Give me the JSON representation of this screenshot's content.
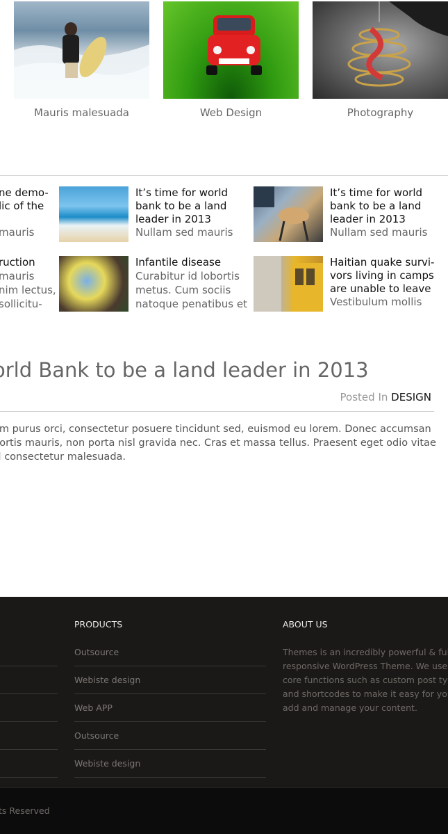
{
  "gallery": [
    {
      "caption": "Mauris malesuada"
    },
    {
      "caption": "Web Design"
    },
    {
      "caption": "Photography"
    }
  ],
  "related": {
    "left_column": [
      {
        "line1": "ne demo-",
        "line2": "lic of the",
        "line3": "",
        "line4": "mauris"
      },
      {
        "line1": "ruction",
        "line2": "mauris",
        "line3": "nim lectus,",
        "line4": "sollicitu-"
      }
    ],
    "posts": [
      {
        "title_lines": [
          "It’s time for world",
          "bank to be a land",
          "leader in 2013"
        ],
        "excerpt_lines": [
          "Nullam sed mauris"
        ]
      },
      {
        "title_lines": [
          "It’s time for world",
          "bank to be a land",
          "leader in 2013"
        ],
        "excerpt_lines": [
          "Nullam sed mauris"
        ]
      },
      {
        "title_lines": [
          "Infantile disease"
        ],
        "excerpt_lines": [
          "Curabitur id lobortis",
          "metus. Cum sociis",
          "natoque penatibus et"
        ]
      },
      {
        "title_lines": [
          "Haitian quake survi-",
          "vors living in camps",
          "are unable to leave"
        ],
        "excerpt_lines": [
          "Vestibulum mollis"
        ]
      }
    ]
  },
  "article": {
    "title": "orld Bank to be a land leader in 2013",
    "posted_in_label": "Posted In",
    "category": "DESIGN",
    "body_lines": [
      "am purus orci, consectetur posuere tincidunt sed, euismod eu lorem. Donec accumsan",
      "bortis mauris, non porta nisl gravida nec. Cras et massa tellus. Praesent eget odio vitae",
      "sl consectetur malesuada."
    ]
  },
  "footer": {
    "products_heading": "PRODUCTS",
    "products": [
      "Outsource",
      "Webiste design",
      "Web APP",
      "Outsource",
      "Webiste design"
    ],
    "about_heading": "ABOUT US",
    "about_lines": [
      "Themes is an incredibly powerful & fully",
      "responsive WordPress Theme. We use onl",
      "core functions such as custom post types",
      "and shortcodes to make it easy for you to",
      "add and manage your content."
    ],
    "copyright": "ts Reserved"
  },
  "colors": {
    "footer_bg": "#1b1918",
    "bottom_bar_bg": "#0d0c0c",
    "divider": "#cfcfcf",
    "link_muted": "#7a7672"
  }
}
